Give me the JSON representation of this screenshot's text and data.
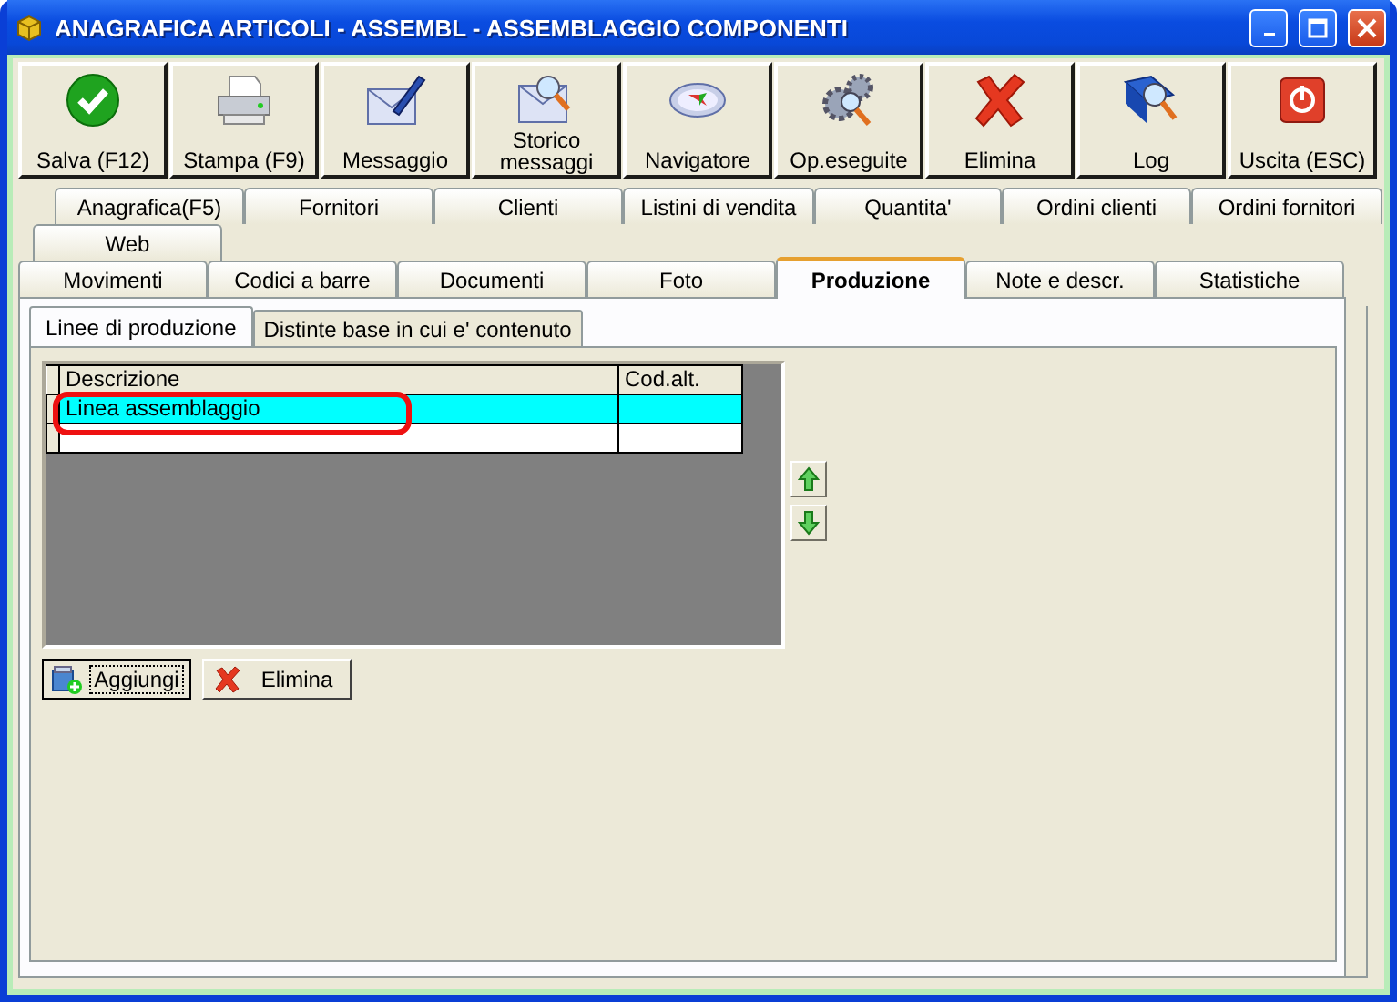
{
  "window": {
    "title": "ANAGRAFICA ARTICOLI - ASSEMBL - ASSEMBLAGGIO COMPONENTI"
  },
  "toolbar": [
    {
      "label": "Salva (F12)"
    },
    {
      "label": "Stampa (F9)"
    },
    {
      "label": "Messaggio"
    },
    {
      "label": "Storico\nmessaggi"
    },
    {
      "label": "Navigatore"
    },
    {
      "label": "Op.eseguite"
    },
    {
      "label": "Elimina"
    },
    {
      "label": "Log"
    },
    {
      "label": "Uscita (ESC)"
    }
  ],
  "tab_rows": [
    [
      {
        "label": "Anagrafica(F5)",
        "selected": false
      },
      {
        "label": "Fornitori",
        "selected": false
      },
      {
        "label": "Clienti",
        "selected": false
      },
      {
        "label": "Listini di vendita",
        "selected": false
      },
      {
        "label": "Quantita'",
        "selected": false
      },
      {
        "label": "Ordini clienti",
        "selected": false
      },
      {
        "label": "Ordini fornitori",
        "selected": false
      }
    ],
    [
      {
        "label": "Web",
        "selected": false
      }
    ],
    [
      {
        "label": "Movimenti",
        "selected": false
      },
      {
        "label": "Codici a barre",
        "selected": false
      },
      {
        "label": "Documenti",
        "selected": false
      },
      {
        "label": "Foto",
        "selected": false
      },
      {
        "label": "Produzione",
        "selected": true
      },
      {
        "label": "Note e descr.",
        "selected": false
      },
      {
        "label": "Statistiche",
        "selected": false
      }
    ]
  ],
  "subtabs": [
    {
      "label": "Linee di produzione",
      "selected": true
    },
    {
      "label": "Distinte base in cui e' contenuto",
      "selected": false
    }
  ],
  "grid": {
    "columns": [
      "Descrizione",
      "Cod.alt."
    ],
    "rows": [
      {
        "descrizione": "Linea assemblaggio",
        "selected": true,
        "highlighted": true
      }
    ]
  },
  "buttons": [
    {
      "label": "Aggiungi",
      "focused": true
    },
    {
      "label": "Elimina",
      "focused": false
    }
  ]
}
